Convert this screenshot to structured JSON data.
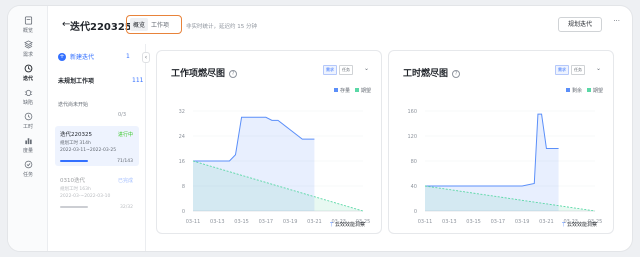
{
  "nav": [
    {
      "label": "概览",
      "icon": "overview-icon"
    },
    {
      "label": "需求",
      "icon": "requirement-icon"
    },
    {
      "label": "迭代",
      "icon": "sprint-icon"
    },
    {
      "label": "缺陷",
      "icon": "bug-icon"
    },
    {
      "label": "工时",
      "icon": "clock-icon"
    },
    {
      "label": "度量",
      "icon": "metrics-icon"
    },
    {
      "label": "任务",
      "icon": "task-icon"
    }
  ],
  "header": {
    "back": "←",
    "title": "迭代220325",
    "tabs": [
      "概览",
      "工作项"
    ],
    "subtitle": "非实时统计，延迟约 15 分钟",
    "plan_button": "规划迭代",
    "more": "···"
  },
  "list": {
    "new_sprint": "新建迭代",
    "new_count": "1",
    "collapse": "‹",
    "unplanned": "未规划工作项",
    "unplanned_count": "111",
    "not_started": "迭代尚未开始",
    "not_started_count": "0/3",
    "sprints": [
      {
        "name": "迭代220325",
        "status": "进行中",
        "hours": "规划工时 314h",
        "dates": "2022-03-11~2022-03-25",
        "progress": "71/143"
      },
      {
        "name": "0310迭代",
        "status": "已完成",
        "hours": "规划工时 163h",
        "dates": "2022-03-~2022-03-10",
        "progress": "32/32"
      }
    ]
  },
  "charts": [
    {
      "title": "工作项燃尽图",
      "help": "?",
      "seg": [
        "需求",
        "任务"
      ],
      "dd": "⌄",
      "legend": [
        "存量",
        "期望"
      ],
      "footer": "云效效能洞察"
    },
    {
      "title": "工时燃尽图",
      "help": "?",
      "seg": [
        "需求",
        "任务"
      ],
      "dd": "⌄",
      "legend": [
        "剩余",
        "期望"
      ],
      "footer": "云效效能洞察"
    }
  ],
  "colors": {
    "actual": "#5b8ff9",
    "ideal": "#5ad8a6",
    "accent": "#3370ff",
    "highlight": "#e8833a"
  },
  "chart_data": [
    {
      "type": "area",
      "title": "工作项燃尽图",
      "x": [
        "03-11",
        "03-12",
        "03-13",
        "03-14",
        "03-15",
        "03-16",
        "03-17",
        "03-18",
        "03-19",
        "03-20",
        "03-21",
        "03-22",
        "03-23",
        "03-24",
        "03-25"
      ],
      "x_ticks": [
        "03-11",
        "03-13",
        "03-15",
        "03-17",
        "03-19",
        "03-21",
        "03-23",
        "03-25"
      ],
      "y_ticks": [
        0,
        8,
        16,
        24,
        32
      ],
      "ylim": [
        0,
        32
      ],
      "series": [
        {
          "name": "存量",
          "points": [
            [
              "03-11",
              16
            ],
            [
              "03-14",
              16
            ],
            [
              "03-14.5",
              18
            ],
            [
              "03-15",
              30
            ],
            [
              "03-16",
              30
            ],
            [
              "03-17",
              30
            ],
            [
              "03-17.5",
              29
            ],
            [
              "03-18",
              29
            ],
            [
              "03-19",
              26
            ],
            [
              "03-20",
              23
            ],
            [
              "03-21",
              23
            ]
          ]
        },
        {
          "name": "期望",
          "points": [
            [
              "03-11",
              16
            ],
            [
              "03-25",
              0
            ]
          ]
        }
      ]
    },
    {
      "type": "area",
      "title": "工时燃尽图",
      "x": [
        "03-11",
        "03-12",
        "03-13",
        "03-14",
        "03-15",
        "03-16",
        "03-17",
        "03-18",
        "03-19",
        "03-20",
        "03-21",
        "03-22",
        "03-23",
        "03-24",
        "03-25"
      ],
      "x_ticks": [
        "03-11",
        "03-13",
        "03-15",
        "03-17",
        "03-19",
        "03-21",
        "03-23",
        "03-25"
      ],
      "y_ticks": [
        0,
        40,
        80,
        120,
        160
      ],
      "ylim": [
        0,
        160
      ],
      "series": [
        {
          "name": "剩余",
          "points": [
            [
              "03-11",
              40
            ],
            [
              "03-19",
              40
            ],
            [
              "03-20",
              44
            ],
            [
              "03-20.3",
              155
            ],
            [
              "03-20.6",
              155
            ],
            [
              "03-21",
              100
            ],
            [
              "03-22",
              100
            ]
          ]
        },
        {
          "name": "期望",
          "points": [
            [
              "03-11",
              40
            ],
            [
              "03-25",
              0
            ]
          ]
        }
      ]
    }
  ]
}
